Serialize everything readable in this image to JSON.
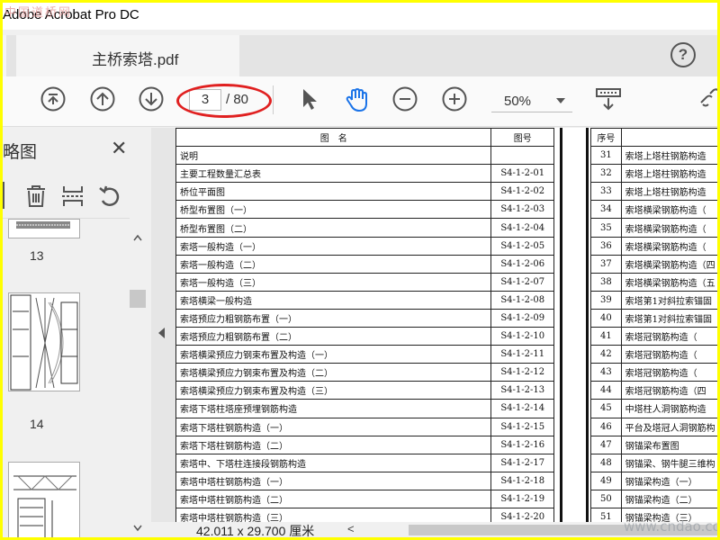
{
  "window": {
    "title": "Adobe Acrobat Pro DC",
    "watermark": "中国道桥网"
  },
  "tab": {
    "label": "主桥索塔.pdf"
  },
  "help": {
    "label": "?"
  },
  "toolbar": {
    "current_page": "3",
    "total_pages": "/ 80",
    "zoom": "50%"
  },
  "panel": {
    "title": "略图",
    "close": "✕",
    "thumbnails": [
      {
        "label": "13"
      },
      {
        "label": "14"
      }
    ]
  },
  "drawing_list": {
    "headers": {
      "name": "图　名",
      "number": "图号",
      "seq": "序号"
    },
    "rows": [
      {
        "name": "说明",
        "number": ""
      },
      {
        "name": "主要工程数量汇总表",
        "number": "S4-1-2-01"
      },
      {
        "name": "桥位平面图",
        "number": "S4-1-2-02"
      },
      {
        "name": "桥型布置图（一）",
        "number": "S4-1-2-03"
      },
      {
        "name": "桥型布置图（二）",
        "number": "S4-1-2-04"
      },
      {
        "name": "索塔一般构造（一）",
        "number": "S4-1-2-05"
      },
      {
        "name": "索塔一般构造（二）",
        "number": "S4-1-2-06"
      },
      {
        "name": "索塔一般构造（三）",
        "number": "S4-1-2-07"
      },
      {
        "name": "索塔横梁一般构造",
        "number": "S4-1-2-08"
      },
      {
        "name": "索塔预应力粗钢筋布置（一）",
        "number": "S4-1-2-09"
      },
      {
        "name": "索塔预应力粗钢筋布置（二）",
        "number": "S4-1-2-10"
      },
      {
        "name": "索塔横梁预应力钢束布置及构造（一）",
        "number": "S4-1-2-11"
      },
      {
        "name": "索塔横梁预应力钢束布置及构造（二）",
        "number": "S4-1-2-12"
      },
      {
        "name": "索塔横梁预应力钢束布置及构造（三）",
        "number": "S4-1-2-13"
      },
      {
        "name": "索塔下塔柱塔座预埋钢筋构造",
        "number": "S4-1-2-14"
      },
      {
        "name": "索塔下塔柱钢筋构造（一）",
        "number": "S4-1-2-15"
      },
      {
        "name": "索塔下塔柱钢筋构造（二）",
        "number": "S4-1-2-16"
      },
      {
        "name": "索塔中、下塔柱连接段钢筋构造",
        "number": "S4-1-2-17"
      },
      {
        "name": "索塔中塔柱钢筋构造（一）",
        "number": "S4-1-2-18"
      },
      {
        "name": "索塔中塔柱钢筋构造（二）",
        "number": "S4-1-2-19"
      },
      {
        "name": "索塔中塔柱钢筋构造（三）",
        "number": "S4-1-2-20"
      }
    ],
    "rows2": [
      {
        "seq": "31",
        "name": "索塔上塔柱钢筋构造"
      },
      {
        "seq": "32",
        "name": "索塔上塔柱钢筋构造"
      },
      {
        "seq": "33",
        "name": "索塔上塔柱钢筋构造"
      },
      {
        "seq": "34",
        "name": "索塔横梁钢筋构造（"
      },
      {
        "seq": "35",
        "name": "索塔横梁钢筋构造（"
      },
      {
        "seq": "36",
        "name": "索塔横梁钢筋构造（"
      },
      {
        "seq": "37",
        "name": "索塔横梁钢筋构造（四"
      },
      {
        "seq": "38",
        "name": "索塔横梁钢筋构造（五"
      },
      {
        "seq": "39",
        "name": "索塔第1对斜拉索锚固"
      },
      {
        "seq": "40",
        "name": "索塔第1对斜拉索锚固"
      },
      {
        "seq": "41",
        "name": "索塔冠钢筋构造（"
      },
      {
        "seq": "42",
        "name": "索塔冠钢筋构造（"
      },
      {
        "seq": "43",
        "name": "索塔冠钢筋构造（"
      },
      {
        "seq": "44",
        "name": "索塔冠钢筋构造（四"
      },
      {
        "seq": "45",
        "name": "中塔柱人洞钢筋构造"
      },
      {
        "seq": "46",
        "name": "平台及塔冠人洞钢筋构"
      },
      {
        "seq": "47",
        "name": "钢锚梁布置图"
      },
      {
        "seq": "48",
        "name": "钢锚梁、钢牛腿三维构"
      },
      {
        "seq": "49",
        "name": "钢锚梁构造（一）"
      },
      {
        "seq": "50",
        "name": "钢锚梁构造（二）"
      },
      {
        "seq": "51",
        "name": "钢锚梁构造（三）"
      }
    ]
  },
  "statusbar": {
    "page_size": "42.011 x 29.700 厘米",
    "scroll_left": "<",
    "watermark": "www.cndao.com"
  },
  "colors": {
    "frame": "#ffff00",
    "annotation": "#e02020",
    "hand_tool": "#1a73e8"
  }
}
